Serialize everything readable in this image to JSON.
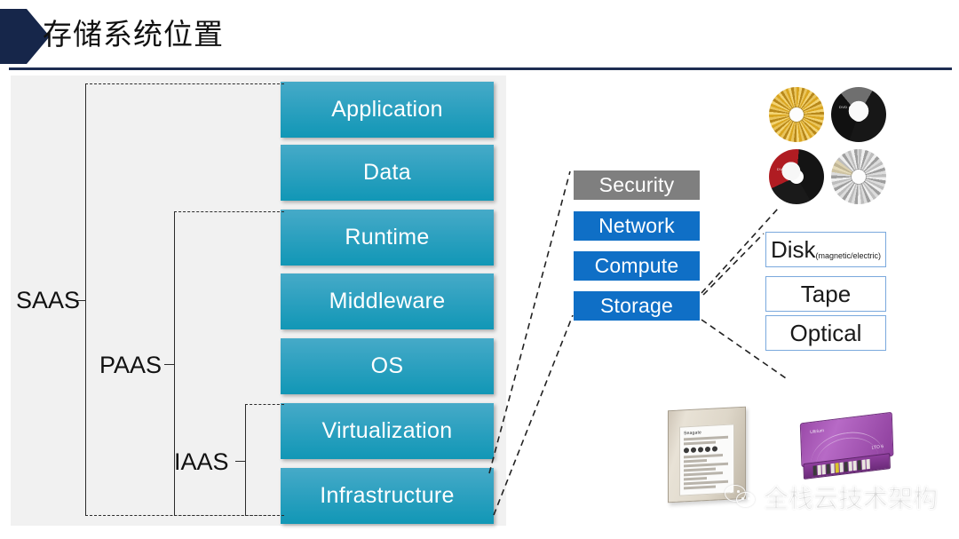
{
  "header": {
    "title": "存储系统位置",
    "arrow_icon": "chevron-right-shape",
    "accent_color": "#16264a"
  },
  "stack": {
    "panel_color": "#f1f1f1",
    "box_color_top": "#46aac8",
    "box_color_bottom": "#1197b6",
    "layers": [
      {
        "label": "Application"
      },
      {
        "label": "Data"
      },
      {
        "label": "Runtime"
      },
      {
        "label": "Middleware"
      },
      {
        "label": "OS"
      },
      {
        "label": "Virtualization"
      },
      {
        "label": "Infrastructure"
      }
    ]
  },
  "brackets": [
    {
      "label": "SAAS",
      "covers": "Application..Infrastructure"
    },
    {
      "label": "PAAS",
      "covers": "Runtime..Infrastructure"
    },
    {
      "label": "IAAS",
      "covers": "Virtualization..Infrastructure"
    }
  ],
  "infra_stack": {
    "items": [
      {
        "label": "Security",
        "color": "#7f7f7f",
        "style": "gray"
      },
      {
        "label": "Network",
        "color": "#0f6fc6",
        "style": "blue"
      },
      {
        "label": "Compute",
        "color": "#0f6fc6",
        "style": "blue"
      },
      {
        "label": "Storage",
        "color": "#0f6fc6",
        "style": "blue"
      }
    ]
  },
  "media_stack": {
    "border_color": "#7aa9dd",
    "items": [
      {
        "label": "Disk",
        "sub": "(magnetic/electric)"
      },
      {
        "label": "Tape",
        "sub": ""
      },
      {
        "label": "Optical",
        "sub": ""
      }
    ]
  },
  "images": {
    "optical_discs": [
      {
        "name": "disc-gold",
        "tint": "#d9a520"
      },
      {
        "name": "disc-black",
        "tint": "#171717",
        "label": "DVD disk"
      },
      {
        "name": "disc-red",
        "tint": "#b01c22",
        "label": "DVD disk"
      },
      {
        "name": "disc-silver",
        "tint": "#bdbdbd"
      }
    ],
    "ssd": {
      "name": "ssd-drive-photo",
      "brand": "Seagate"
    },
    "tape": {
      "name": "lto-tape-cartridge-photo",
      "brand": "Ultrium",
      "model": "LTO 6"
    }
  },
  "watermark": {
    "text": "全栈云技术架构",
    "icon": "wechat-icon"
  }
}
